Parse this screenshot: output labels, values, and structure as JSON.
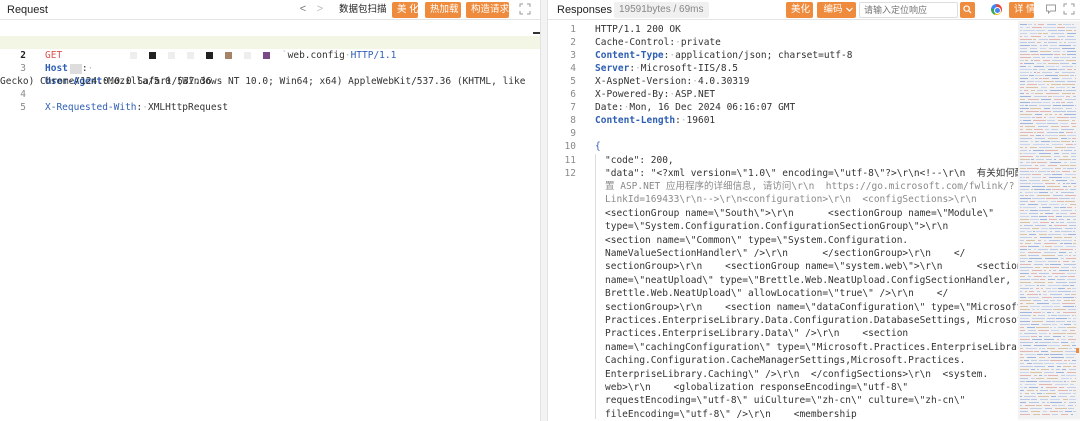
{
  "request": {
    "title": "Request",
    "nav": {
      "back": "<",
      "forward": ">"
    },
    "buttons": {
      "scan": "数据包扫描",
      "beautify": "美 化",
      "hot_load": "热加载",
      "build_request": "构造请求"
    },
    "lines": [
      {
        "num": "1",
        "method": "GET",
        "path_suffix": "web.config",
        "protocol": "HTTP/1.1"
      },
      {
        "num": "2",
        "name": "Host",
        "colon": ":"
      },
      {
        "num": "3",
        "name": "User-Agent",
        "value": "Mozilla/5.0 (Windows NT 10.0; Win64; x64) AppleWebKit/537.36 (KHTML, like",
        "value_cont": "Gecko) Chrome/124.0.0.0 Safari/537.36"
      },
      {
        "num": "4",
        "name": "X-Requested-With",
        "value": "XMLHttpRequest"
      },
      {
        "num": "5"
      }
    ]
  },
  "response": {
    "title": "Responses",
    "stats": "19591bytes / 69ms",
    "buttons": {
      "beautify": "美化",
      "encoding": "编码",
      "details": "详 情"
    },
    "search": {
      "placeholder": "请输入定位响应"
    },
    "header_lines": [
      {
        "num": "1",
        "text": "HTTP/1.1 200 OK"
      },
      {
        "num": "2",
        "name": "Cache-Control",
        "value": "private"
      },
      {
        "num": "3",
        "name": "Content-Type",
        "value": "application/json; charset=utf-8"
      },
      {
        "num": "4",
        "name": "Server",
        "value": "Microsoft-IIS/8.5"
      },
      {
        "num": "5",
        "name": "X-AspNet-Version",
        "value": "4.0.30319"
      },
      {
        "num": "6",
        "name": "X-Powered-By",
        "value": "ASP.NET"
      },
      {
        "num": "7",
        "name": "Date",
        "value": "Mon, 16 Dec 2024 06:16:07 GMT"
      },
      {
        "num": "8",
        "name": "Content-Length",
        "value": "19601"
      },
      {
        "num": "9"
      },
      {
        "num": "10",
        "text": "{"
      },
      {
        "num": "11",
        "text": "\"code\": 200,"
      },
      {
        "num": "12",
        "text": "\"data\": \"<?xml version=\\\"1.0\\\" encoding=\\\"utf-8\\\"?>\\r\\n<!--\\r\\n  有关如何配"
      }
    ],
    "wrapped_lines": [
      "置 ASP.NET 应用程序的详细信息, 请访问\\r\\n  https://go.microsoft.com/fwlink/?",
      "LinkId=169433\\r\\n-->\\r\\n<configuration>\\r\\n  <configSections>\\r\\n    ",
      "<sectionGroup name=\\\"South\\\">\\r\\n      <sectionGroup name=\\\"Module\\\"",
      "type=\\\"System.Configuration.ConfigurationSectionGroup\\\">\\r\\n        ",
      "<section name=\\\"Common\\\" type=\\\"System.Configuration.",
      "NameValueSectionHandler\\\" />\\r\\n      </sectionGroup>\\r\\n    </",
      "sectionGroup>\\r\\n    <sectionGroup name=\\\"system.web\\\">\\r\\n      <section",
      "name=\\\"neatUpload\\\" type=\\\"Brettle.Web.NeatUpload.ConfigSectionHandler,",
      "Brettle.Web.NeatUpload\\\" allowLocation=\\\"true\\\" />\\r\\n    </",
      "sectionGroup>\\r\\n    <section name=\\\"dataConfiguration\\\" type=\\\"Microsoft.",
      "Practices.EnterpriseLibrary.Data.Configuration.DatabaseSettings, Microsoft.",
      "Practices.EnterpriseLibrary.Data\\\" />\\r\\n    <section",
      "name=\\\"cachingConfiguration\\\" type=\\\"Microsoft.Practices.EnterpriseLibrary.",
      "Caching.Configuration.CacheManagerSettings,Microsoft.Practices.",
      "EnterpriseLibrary.Caching\\\" />\\r\\n  </configSections>\\r\\n  <system.",
      "web>\\r\\n    <globalization responseEncoding=\\\"utf-8\\\"",
      "requestEncoding=\\\"utf-8\\\" uiCulture=\\\"zh-cn\\\" culture=\\\"zh-cn\\\"",
      "fileEncoding=\\\"utf-8\\\" />\\r\\n    <membership"
    ]
  },
  "colors": {
    "accent_orange": "#ef8b3c",
    "keyword_blue": "#2f5fb3",
    "method_red": "#d9534f"
  },
  "icons": [
    "expand-icon",
    "search-icon",
    "chevron-down-icon",
    "chrome-color-icon",
    "chat-icon",
    "fullscreen-icon"
  ]
}
